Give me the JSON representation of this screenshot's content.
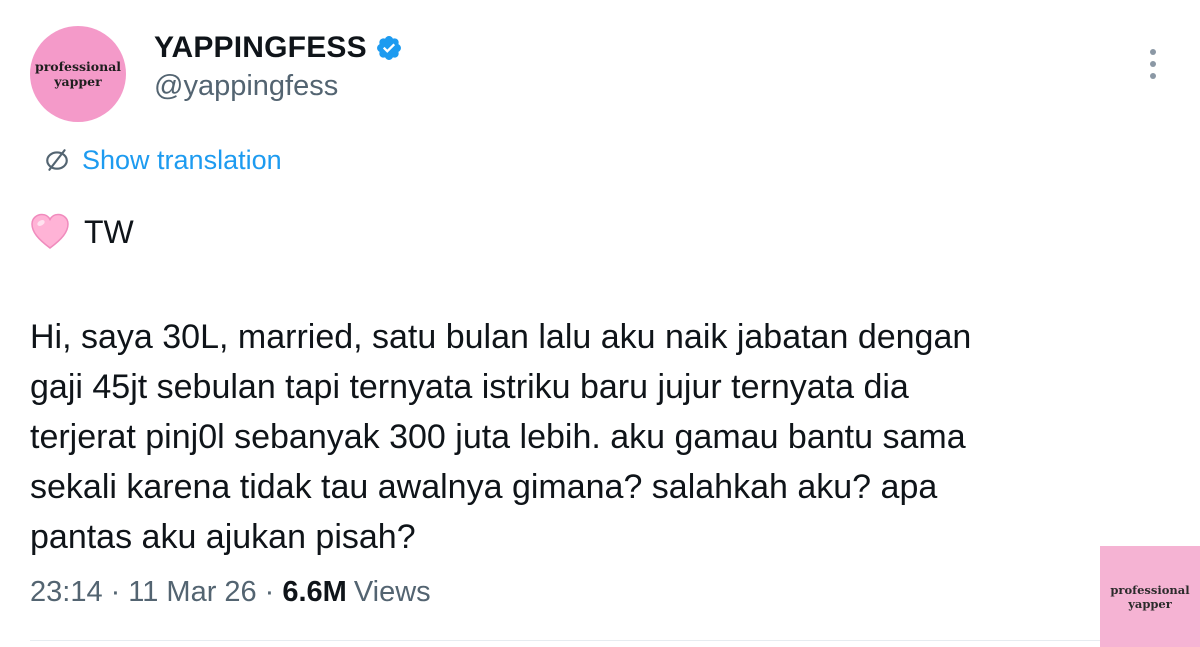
{
  "author": {
    "avatar_text": {
      "line1": "professional",
      "line2": "yapper"
    },
    "display_name": "YAPPINGFESS",
    "verified": true,
    "handle": "@yappingfess"
  },
  "menu": {
    "more_icon": "more-vertical-icon"
  },
  "translation": {
    "icon": "translate-icon",
    "label": "Show translation"
  },
  "tweet": {
    "tag_icon": "pink-heart-icon",
    "tag_text": "TW",
    "body_lines": [
      "Hi, saya 30L, married, satu bulan lalu aku naik jabatan dengan",
      "gaji 45jt sebulan tapi ternyata istriku baru jujur ternyata dia",
      "terjerat pinj0l sebanyak 300 juta lebih. aku gamau bantu sama",
      "sekali karena tidak tau awalnya gimana? salahkah aku? apa",
      "pantas aku ajukan pisah?"
    ]
  },
  "meta": {
    "time": "23:14",
    "separator": "·",
    "date": "11 Mar 26",
    "views_count": "6.6M",
    "views_label": "Views"
  },
  "watermark": {
    "line1": "professional",
    "line2": "yapper"
  },
  "colors": {
    "link_blue": "#1d9bf0",
    "verified_blue": "#1d9bf0",
    "muted_gray": "#536471",
    "text_dark": "#0f1419",
    "avatar_pink": "#f49ac9",
    "watermark_pink": "#f5b3d3",
    "heart_pink": "#ffb3d6"
  }
}
